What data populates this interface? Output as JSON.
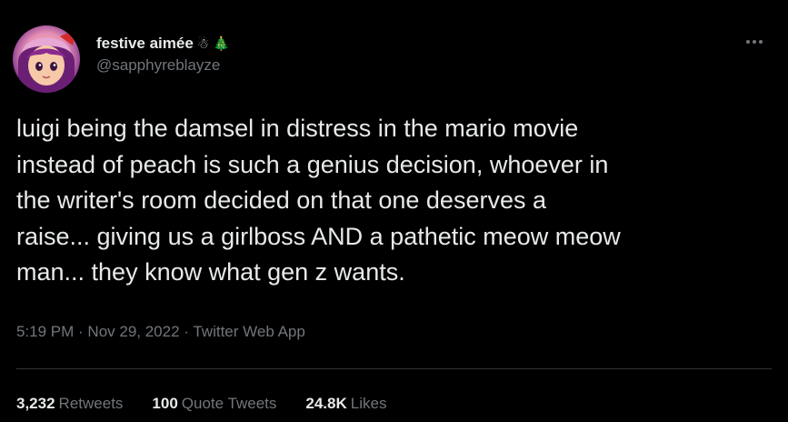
{
  "user": {
    "display_name": "festive aimée",
    "name_emoji_1": "☃",
    "name_emoji_2": "🎄",
    "handle": "@sapphyreblayze",
    "avatar_icon": "anime-avatar"
  },
  "tweet": {
    "text": "luigi being the damsel in distress in the mario movie\ninstead of peach is such a genius decision, whoever in\nthe writer's room decided on that one deserves a\nraise... giving us a girlboss AND a pathetic meow meow\nman... they know what gen z wants.",
    "meta": "5:19 PM · Nov 29, 2022 · Twitter Web App"
  },
  "stats": {
    "retweets_count": "3,232",
    "retweets_label": "Retweets",
    "quotes_count": "100",
    "quotes_label": "Quote Tweets",
    "likes_count": "24.8K",
    "likes_label": "Likes"
  },
  "colors": {
    "background": "#000000",
    "primary_text": "#e7e9ea",
    "secondary_text": "#71767b",
    "divider": "#2f3336"
  }
}
